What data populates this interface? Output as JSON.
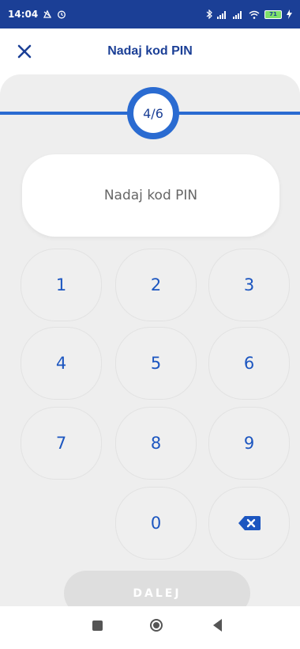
{
  "status_bar": {
    "time": "14:04",
    "battery": "71"
  },
  "header": {
    "title": "Nadaj kod PIN"
  },
  "progress": {
    "step": "4/6"
  },
  "pin": {
    "prompt": "Nadaj kod PIN"
  },
  "keypad": {
    "k1": "1",
    "k2": "2",
    "k3": "3",
    "k4": "4",
    "k5": "5",
    "k6": "6",
    "k7": "7",
    "k8": "8",
    "k9": "9",
    "k0": "0"
  },
  "actions": {
    "next_label": "DALEJ"
  },
  "icons": {
    "close": "close-icon",
    "backspace": "backspace-icon",
    "recents": "recents-icon",
    "home": "home-icon",
    "back": "back-icon"
  },
  "colors": {
    "status_bar": "#1b3f96",
    "primary_blue": "#2a6bd1",
    "text_blue": "#1c56c0",
    "content_bg": "#eeeeee",
    "disabled_button": "#dedede"
  }
}
